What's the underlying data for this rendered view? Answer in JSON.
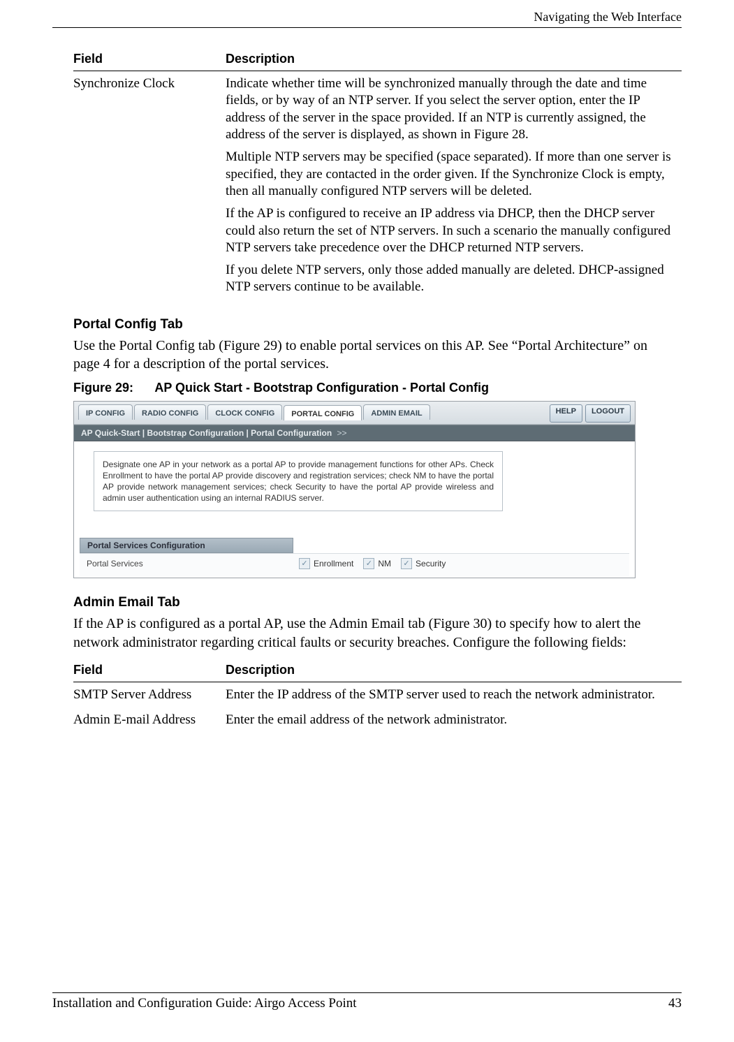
{
  "header": {
    "running": "Navigating the Web Interface"
  },
  "table1": {
    "headers": {
      "field": "Field",
      "desc": "Description"
    },
    "row": {
      "field": "Synchronize Clock",
      "p1": "Indicate whether time will be synchronized manually through the date and time fields, or by way of an NTP server. If you select the server option, enter the IP address of the server in the space provided. If an NTP is currently assigned, the address of the server is displayed, as shown in Figure 28.",
      "p2": "Multiple NTP servers may be specified (space separated). If more than one server is specified, they are contacted in the order given. If the Synchronize Clock is empty, then all manually configured NTP servers will be deleted.",
      "p3": "If the AP is configured to receive an IP address via DHCP, then the DHCP server could also return the set of NTP servers. In such a scenario the manually configured NTP servers take precedence over the DHCP returned NTP servers.",
      "p4": "If you delete NTP servers, only those added manually are deleted. DHCP-assigned NTP servers continue to be available."
    }
  },
  "portal": {
    "heading": "Portal Config Tab",
    "body": "Use the Portal Config tab (Figure 29) to enable portal services on this AP. See “Portal Architecture” on page 4 for a description of the portal services.",
    "figlabel": "Figure 29:",
    "figtitle": "AP Quick Start - Bootstrap Configuration - Portal Config"
  },
  "shot": {
    "tabs": {
      "ip": "IP CONFIG",
      "radio": "RADIO CONFIG",
      "clock": "CLOCK CONFIG",
      "portal": "PORTAL CONFIG",
      "email": "ADMIN EMAIL"
    },
    "buttons": {
      "help": "HELP",
      "logout": "LOGOUT"
    },
    "breadcrumb": "AP Quick-Start | Bootstrap Configuration | Portal Configuration",
    "crumb_suffix": ">>",
    "desc": "Designate one AP in your network as a portal AP to provide management functions for other APs. Check Enrollment to have the portal AP provide discovery and registration services; check NM to have the portal AP provide network management services; check Security to have the portal AP provide wireless and admin user authentication using an internal RADIUS server.",
    "subhead": "Portal Services Configuration",
    "svc_label": "Portal Services",
    "checks": {
      "enroll": "Enrollment",
      "nm": "NM",
      "sec": "Security"
    }
  },
  "admin": {
    "heading": "Admin Email Tab",
    "body": "If the AP is configured as a portal AP, use the Admin Email tab (Figure 30) to specify how to alert the network administrator regarding critical faults or security breaches. Configure the following fields:"
  },
  "table2": {
    "headers": {
      "field": "Field",
      "desc": "Description"
    },
    "rows": [
      {
        "field": "SMTP Server Address",
        "desc": "Enter the IP address of the SMTP server used to reach the network administrator."
      },
      {
        "field": "Admin E-mail Address",
        "desc": "Enter the email address of the network administrator."
      }
    ]
  },
  "footer": {
    "left": "Installation and Configuration Guide: Airgo Access Point",
    "right": "43"
  }
}
